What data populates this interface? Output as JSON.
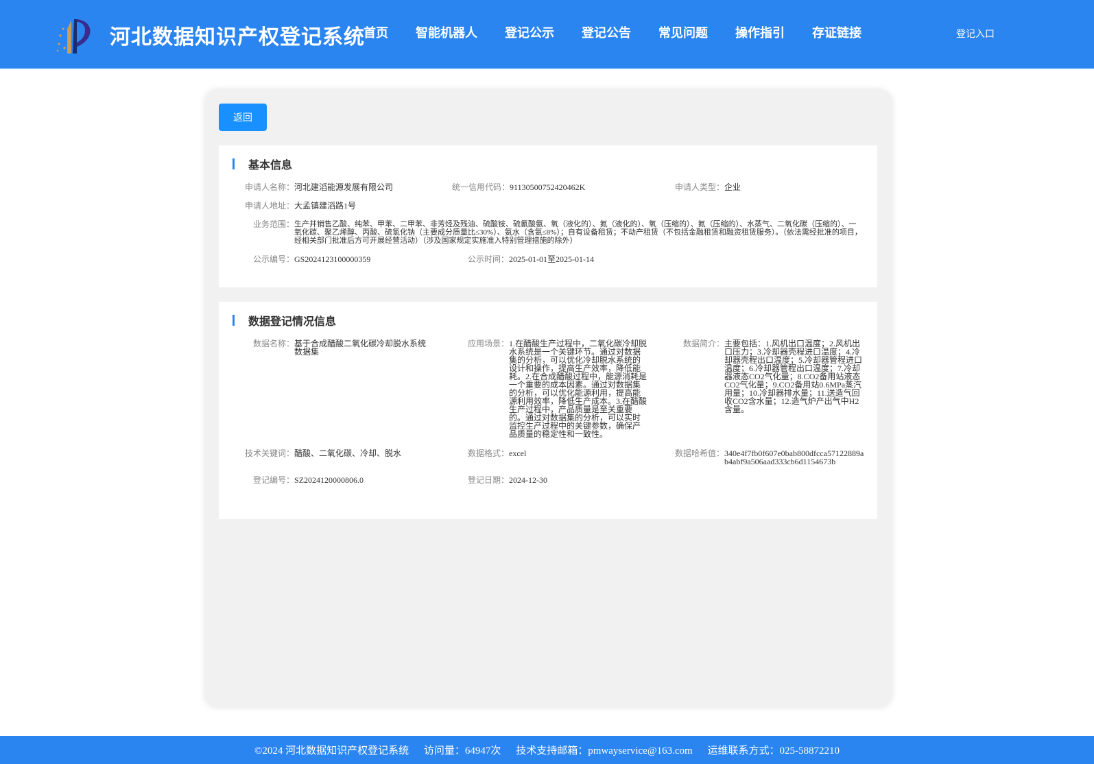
{
  "header": {
    "site_title": "河北数据知识产权登记系统",
    "nav": [
      "首页",
      "智能机器人",
      "登记公示",
      "登记公告",
      "常见问题",
      "操作指引",
      "存证链接"
    ],
    "login": "登记入口"
  },
  "back_button": "返回",
  "basic_info": {
    "title": "基本信息",
    "applicant_name_label": "申请人名称：",
    "applicant_name": "河北建滔能源发展有限公司",
    "credit_code_label": "统一信用代码：",
    "credit_code": "91130500752420462K",
    "applicant_type_label": "申请人类型：",
    "applicant_type": "企业",
    "address_label": "申请人地址：",
    "address": "大孟镇建滔路1号",
    "scope_label": "业务范围：",
    "scope": "生产并销售乙酸、纯苯、甲苯、二甲苯、非芳烃及残油、硫酸铵、硫氰酸氨、氧（液化的）、氮（液化的）、氧（压缩的）、氮（压缩的）、水蒸气、二氧化碳（压缩的）、一氧化碳、聚乙烯醇、丙酸、硫氢化钠（主要成分质量比≤30%）、氨水（含氨≤8%）；自有设备租赁；不动产租赁（不包括金融租赁和融资租赁服务）。（依法需经批准的项目，经相关部门批准后方可开展经营活动）（涉及国家规定实施准入特别管理措施的除外）",
    "notice_no_label": "公示编号：",
    "notice_no": "GS2024123100000359",
    "notice_time_label": "公示时间：",
    "notice_time": "2025-01-01至2025-01-14"
  },
  "data_info": {
    "title": "数据登记情况信息",
    "data_name_label": "数据名称：",
    "data_name": "基于合成醋酸二氧化碳冷却脱水系统数据集",
    "scenario_label": "应用场景：",
    "scenario": "1.在醋酸生产过程中，二氧化碳冷却脱水系统是一个关键环节。通过对数据集的分析，可以优化冷却脱水系统的设计和操作，提高生产效率，降低能耗。2.在合成醋酸过程中，能源消耗是一个重要的成本因素。通过对数据集的分析，可以优化能源利用，提高能源利用效率，降低生产成本。3.在醋酸生产过程中，产品质量是至关重要的。通过对数据集的分析，可以实时监控生产过程中的关键参数，确保产品质量的稳定性和一致性。",
    "summary_label": "数据简介：",
    "summary": "主要包括：1.风机出口温度；2.风机出口压力；3.冷却器壳程进口温度；4.冷却器壳程出口温度；5.冷却器管程进口温度；6.冷却器管程出口温度；7.冷却器液态CO2气化量；8.CO2备用站液态CO2气化量；9.CO2备用站0.6MPa蒸汽用量；10.冷却器排水量；11.送造气回收CO2含水量；12.造气炉产出气中H2含量。",
    "keywords_label": "技术关键词：",
    "keywords": "醋酸、二氧化碳、冷却、脱水",
    "format_label": "数据格式：",
    "format": "excel",
    "hash_label": "数据哈希值：",
    "hash": "340e4f7fb0f607e0bab800dfcca57122889ab4abf9a506aad333cb6d1154673b",
    "reg_no_label": "登记编号：",
    "reg_no": "SZ2024120000806.0",
    "reg_date_label": "登记日期：",
    "reg_date": "2024-12-30"
  },
  "footer": {
    "copyright": "©2024 河北数据知识产权登记系统",
    "visits": "访问量：64947次",
    "email": "技术支持邮箱：pmwayservice@163.com",
    "contact": "运维联系方式：025-58872210"
  },
  "colors": {
    "primary": "#2b85f0",
    "button": "#1890ff",
    "panel_bg": "#f1f1f1"
  },
  "icons": {
    "logo": "logo-icon"
  }
}
